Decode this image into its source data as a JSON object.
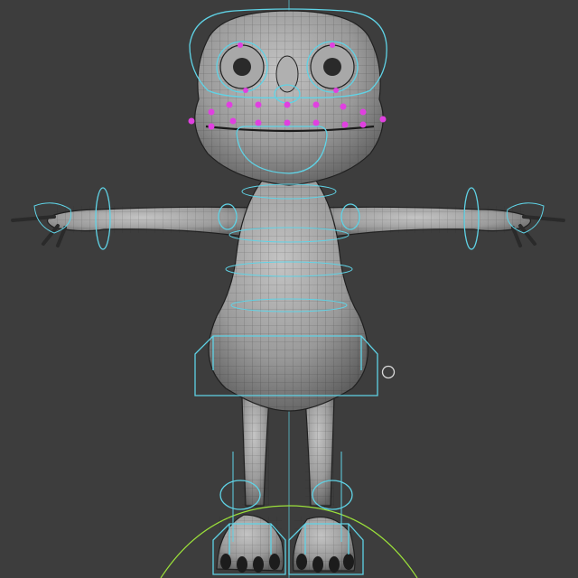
{
  "app": {
    "view": "perspective-viewport"
  },
  "colors": {
    "background": "#3d3d3d",
    "mesh": "#9a9a9a",
    "wireframe": "#1f1f1f",
    "rig_controls": "#5fd3e6",
    "face_controls": "#e040e0",
    "root_control": "#9be03a",
    "world_axis": "#5fd3e6"
  },
  "scene": {
    "model": "cartoon-frog-character",
    "pose": "T-pose",
    "display": "smooth-shaded-with-wireframe",
    "icons": [
      "viewport-pivot-icon"
    ]
  }
}
